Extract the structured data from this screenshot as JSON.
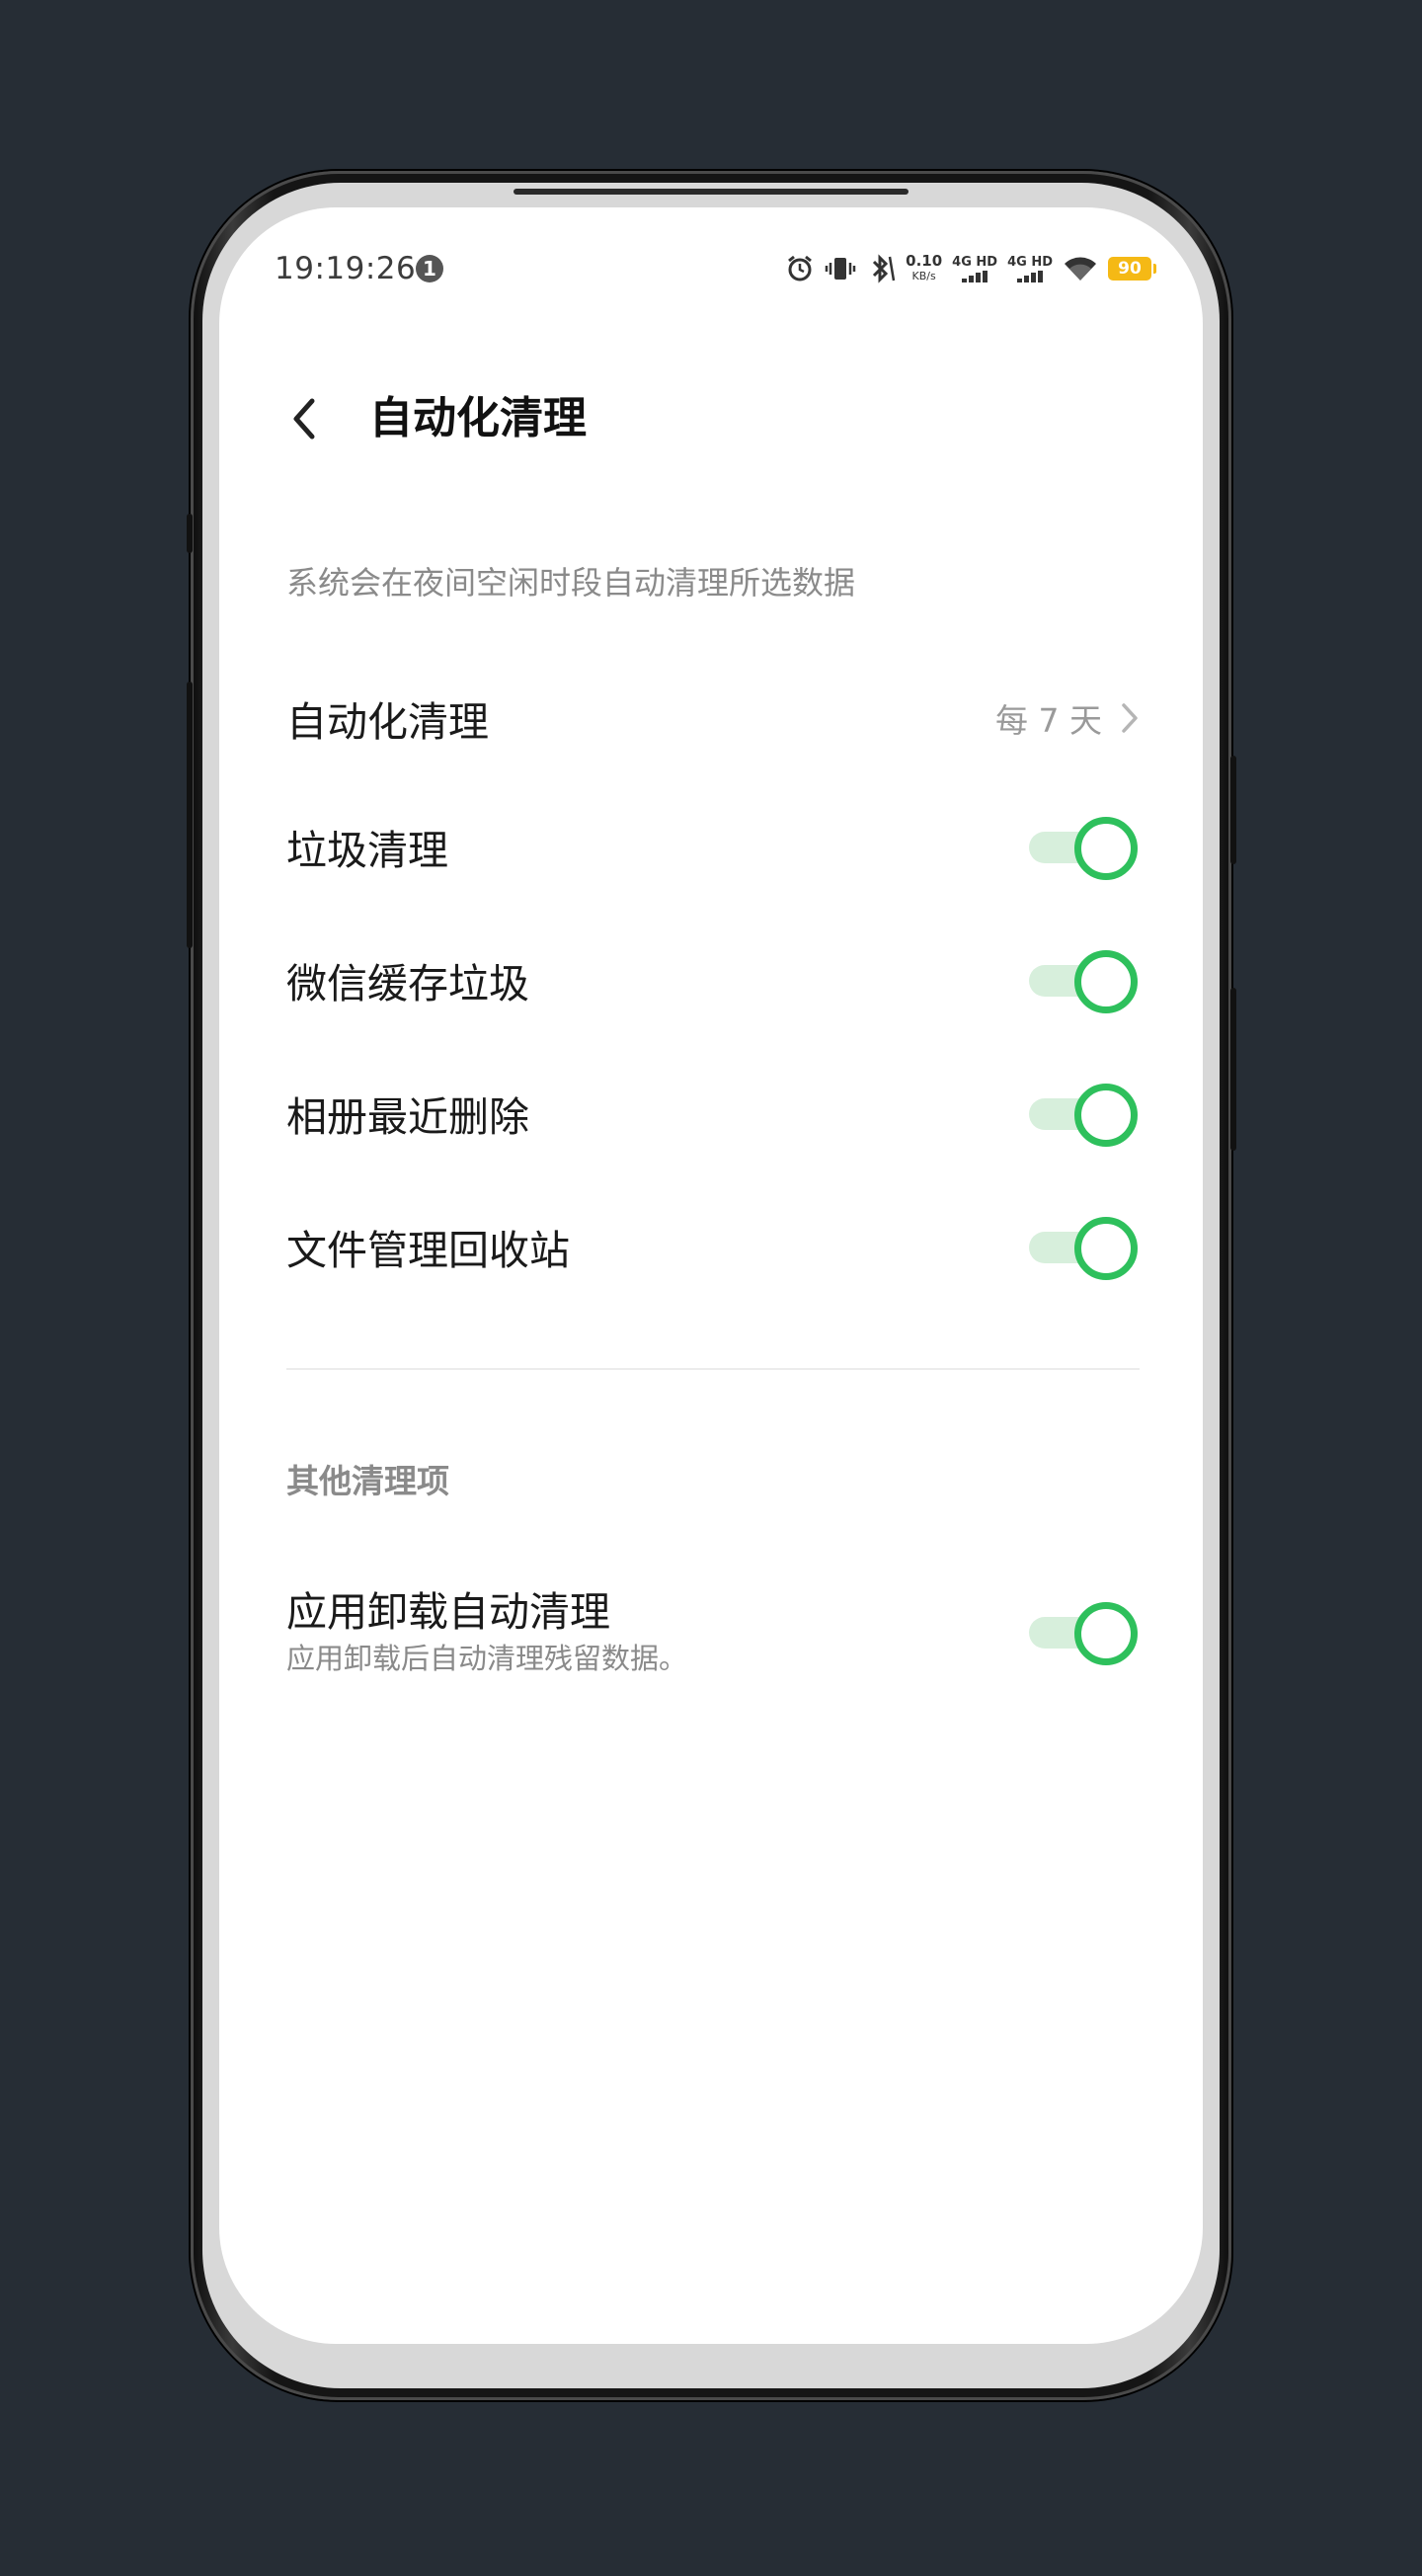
{
  "status_bar": {
    "time": "19:19:26",
    "notification_badge": "1",
    "net_speed_value": "0.10",
    "net_speed_unit": "KB/s",
    "sim1_label": "4G HD",
    "sim2_label": "4G HD",
    "battery": "90",
    "battery_color": "#f5b915"
  },
  "header": {
    "title": "自动化清理"
  },
  "description": "系统会在夜间空闲时段自动清理所选数据",
  "schedule_row": {
    "label": "自动化清理",
    "value": "每 7 天"
  },
  "toggles": [
    {
      "label": "垃圾清理",
      "on": true
    },
    {
      "label": "微信缓存垃圾",
      "on": true
    },
    {
      "label": "相册最近删除",
      "on": true
    },
    {
      "label": "文件管理回收站",
      "on": true
    }
  ],
  "other_section": {
    "title": "其他清理项",
    "item": {
      "label": "应用卸载自动清理",
      "sublabel": "应用卸载后自动清理残留数据。",
      "on": true
    }
  },
  "colors": {
    "toggle_on": "#2ec05c",
    "toggle_track": "#d7efdc",
    "background": "#262d35"
  }
}
